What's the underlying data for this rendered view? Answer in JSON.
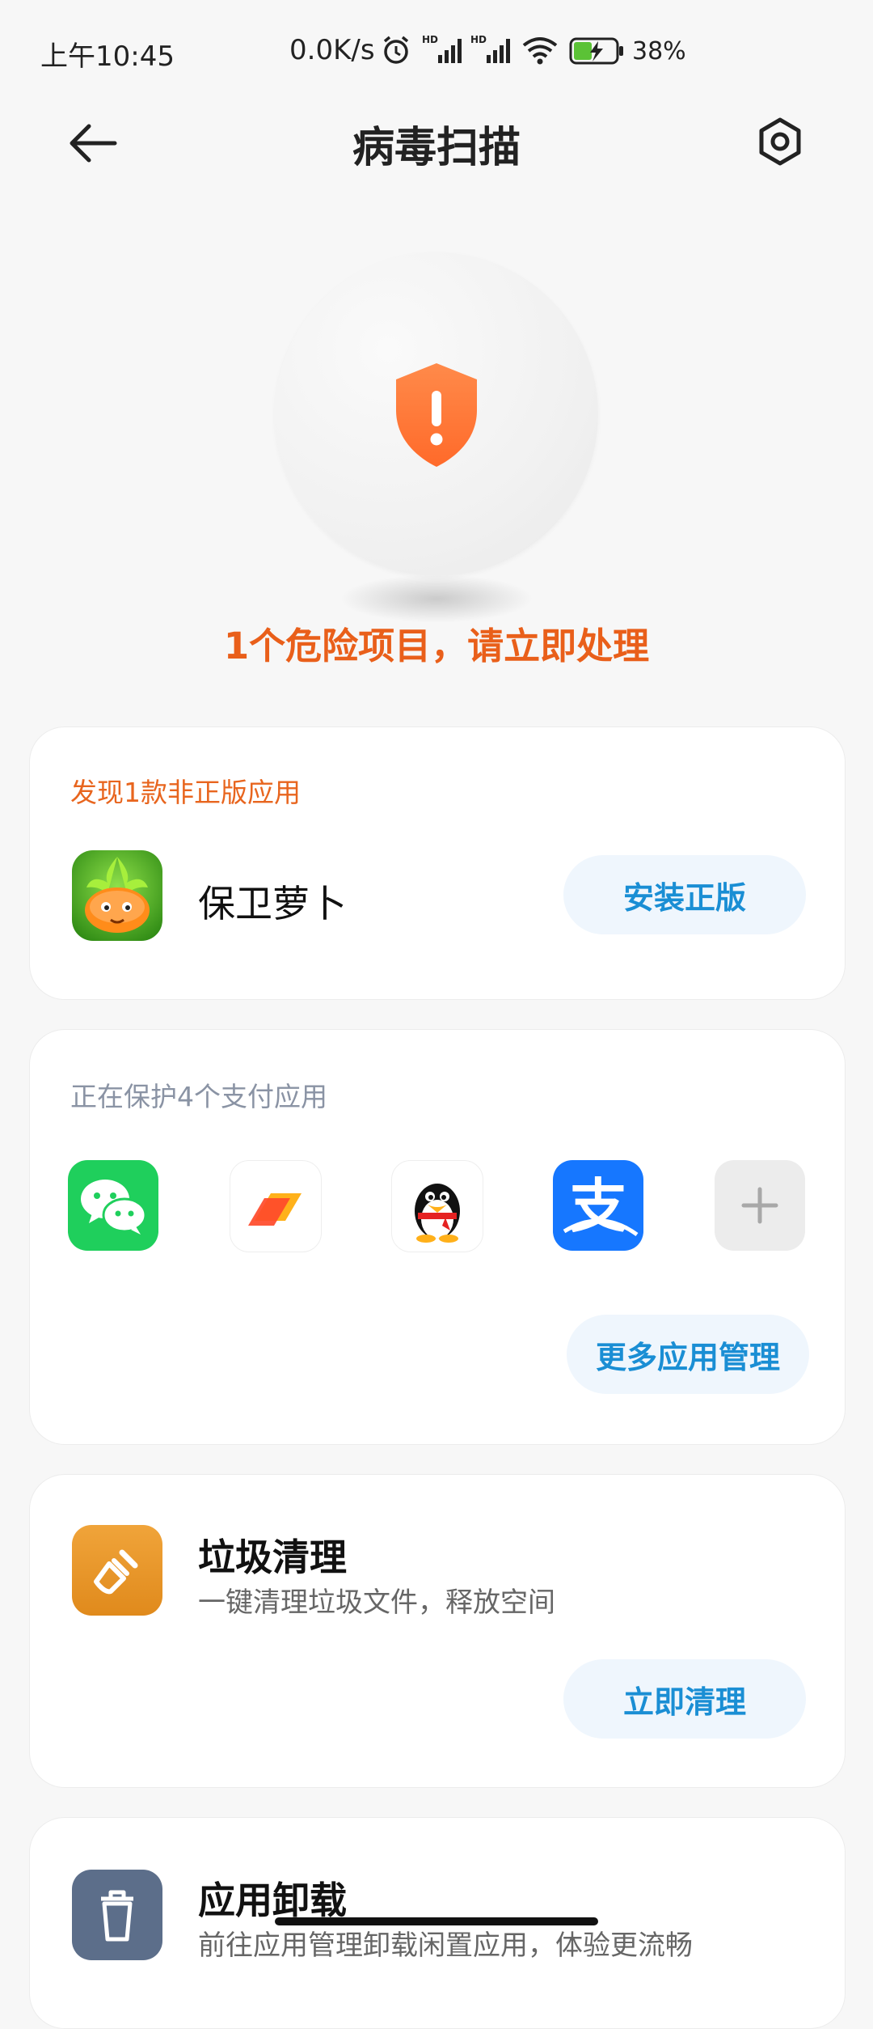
{
  "status_bar": {
    "time": "上午10:45",
    "net_speed": "0.0K/s",
    "battery": "38%"
  },
  "header": {
    "title": "病毒扫描"
  },
  "hero": {
    "warning": "1个危险项目，请立即处理",
    "shield_color": "#ff7a3d"
  },
  "pirated_card": {
    "label": "发现1款非正版应用",
    "app_name": "保卫萝卜",
    "button": "安装正版"
  },
  "payment_card": {
    "label": "正在保护4个支付应用",
    "apps": [
      "wechat",
      "stack-app",
      "qq",
      "alipay"
    ],
    "button": "更多应用管理"
  },
  "clean_card": {
    "title": "垃圾清理",
    "subtitle": "一键清理垃圾文件，释放空间",
    "button": "立即清理"
  },
  "uninstall_card": {
    "title": "应用卸载",
    "subtitle": "前往应用管理卸载闲置应用，体验更流畅"
  },
  "colors": {
    "accent_blue": "#1a8ed4",
    "warning_orange": "#e95f1a"
  }
}
